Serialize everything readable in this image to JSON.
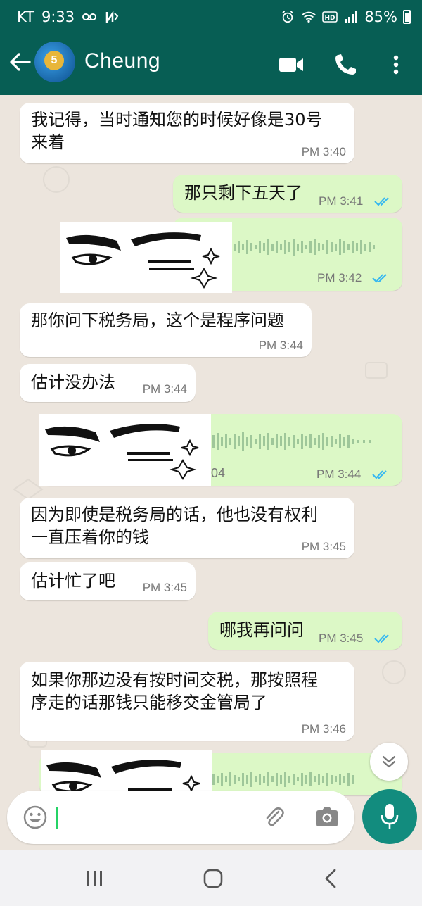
{
  "status_bar": {
    "carrier": "KT",
    "time": "9:33",
    "battery": "85%",
    "icons": [
      "voicemail-icon",
      "nfc-icon",
      "alarm-icon",
      "wifi-icon",
      "hd-voice-icon",
      "signal-icon",
      "battery-icon"
    ]
  },
  "header": {
    "contact_name": "Cheung",
    "icons": [
      "back-arrow-icon",
      "video-call-icon",
      "phone-icon",
      "more-vert-icon"
    ]
  },
  "messages": [
    {
      "dir": "in",
      "text_line1": "我记得，当时通知您的时候好像是30号",
      "text_line2": "来着",
      "time": "PM 3:40"
    },
    {
      "dir": "out",
      "text": "那只剩下五天了",
      "time": "PM 3:41",
      "read": true
    },
    {
      "dir": "out",
      "type": "voice",
      "time": "PM 3:42",
      "read": true
    },
    {
      "dir": "in",
      "text": "那你问下税务局，这个是程序问题",
      "time": "PM 3:44"
    },
    {
      "dir": "in",
      "text": "估计没办法",
      "time": "PM 3:44"
    },
    {
      "dir": "out",
      "type": "voice",
      "duration": "04",
      "time": "PM 3:44",
      "read": true
    },
    {
      "dir": "in",
      "text_line1": "因为即使是税务局的话，他也没有权利",
      "text_line2": "一直压着你的钱",
      "time": "PM 3:45"
    },
    {
      "dir": "in",
      "text": "估计忙了吧",
      "time": "PM 3:45"
    },
    {
      "dir": "out",
      "text": "哪我再问问",
      "time": "PM 3:45",
      "read": true
    },
    {
      "dir": "in",
      "text_line1": "如果你那边没有按时间交税，那按照程",
      "text_line2": "序走的话那钱只能移交金管局了",
      "time": "PM 3:46"
    },
    {
      "dir": "out",
      "type": "voice",
      "time": ""
    }
  ],
  "composer": {
    "icons": [
      "emoji-icon",
      "attach-icon",
      "camera-icon",
      "mic-icon"
    ]
  },
  "colors": {
    "header": "#075e54",
    "incoming_bubble": "#ffffff",
    "outgoing_bubble": "#dcf8c6",
    "read_ticks": "#34b7f1",
    "mic_button": "#128c7e",
    "chat_background": "#ece5dd"
  }
}
